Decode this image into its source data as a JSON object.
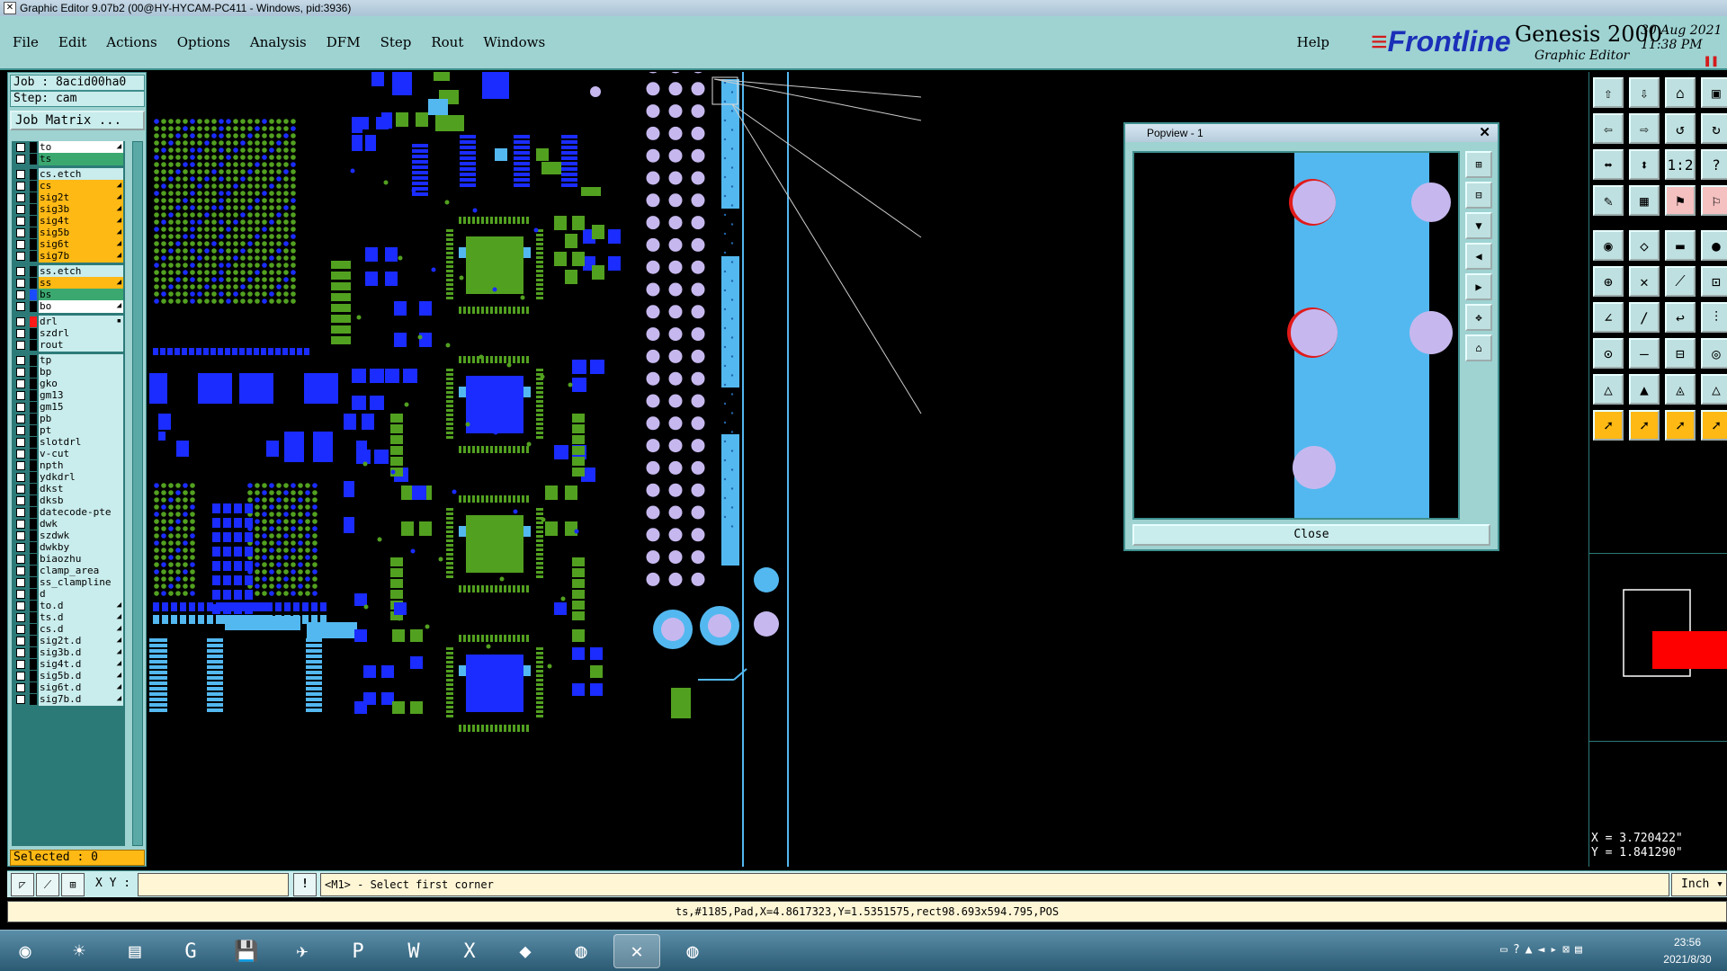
{
  "window": {
    "title": "Graphic Editor 9.07b2 (00@HY-HYCAM-PC411 - Windows, pid:3936)"
  },
  "menu": {
    "items": [
      "File",
      "Edit",
      "Actions",
      "Options",
      "Analysis",
      "DFM",
      "Step",
      "Rout",
      "Windows"
    ],
    "help": "Help"
  },
  "logo": {
    "brand": "Frontline",
    "product": "Genesis 2000",
    "subtitle": "Graphic Editor",
    "date": "30 Aug 2021",
    "time": "11:38 PM"
  },
  "job": {
    "job_label": "Job : 8acid00ha0",
    "step_label": "Step: cam",
    "matrix_button": "Job Matrix ..."
  },
  "layers": [
    {
      "name": "to",
      "color": "#000000",
      "style": "white",
      "mark": "◢"
    },
    {
      "name": "ts",
      "color": "#000000",
      "style": "green",
      "mark": ""
    },
    {
      "name": "cs.etch",
      "color": "#000000",
      "style": "normal",
      "mark": ""
    },
    {
      "name": "cs",
      "color": "#000000",
      "style": "orange",
      "mark": "◢"
    },
    {
      "name": "sig2t",
      "color": "#000000",
      "style": "orange",
      "mark": "◢"
    },
    {
      "name": "sig3b",
      "color": "#000000",
      "style": "orange",
      "mark": "◢"
    },
    {
      "name": "sig4t",
      "color": "#000000",
      "style": "orange",
      "mark": "◢"
    },
    {
      "name": "sig5b",
      "color": "#000000",
      "style": "orange",
      "mark": "◢"
    },
    {
      "name": "sig6t",
      "color": "#000000",
      "style": "orange",
      "mark": "◢"
    },
    {
      "name": "sig7b",
      "color": "#000000",
      "style": "orange",
      "mark": "◢"
    },
    {
      "name": "ss.etch",
      "color": "#000000",
      "style": "normal",
      "mark": ""
    },
    {
      "name": "ss",
      "color": "#000000",
      "style": "orange",
      "mark": "◢"
    },
    {
      "name": "bs",
      "color": "#1a4cff",
      "style": "green",
      "mark": ""
    },
    {
      "name": "bo",
      "color": "#000000",
      "style": "white",
      "mark": "◢"
    },
    {
      "name": "drl",
      "color": "#ff1a1a",
      "style": "normal",
      "mark": "▪"
    },
    {
      "name": "szdrl",
      "color": "#000000",
      "style": "normal",
      "mark": ""
    },
    {
      "name": "rout",
      "color": "#000000",
      "style": "normal",
      "mark": ""
    },
    {
      "name": "tp",
      "color": "#000000",
      "style": "normal",
      "mark": ""
    },
    {
      "name": "bp",
      "color": "#000000",
      "style": "normal",
      "mark": ""
    },
    {
      "name": "gko",
      "color": "#000000",
      "style": "normal",
      "mark": ""
    },
    {
      "name": "gm13",
      "color": "#000000",
      "style": "normal",
      "mark": ""
    },
    {
      "name": "gm15",
      "color": "#000000",
      "style": "normal",
      "mark": ""
    },
    {
      "name": "pb",
      "color": "#000000",
      "style": "normal",
      "mark": ""
    },
    {
      "name": "pt",
      "color": "#000000",
      "style": "normal",
      "mark": ""
    },
    {
      "name": "slotdrl",
      "color": "#000000",
      "style": "normal",
      "mark": ""
    },
    {
      "name": "v-cut",
      "color": "#000000",
      "style": "normal",
      "mark": ""
    },
    {
      "name": "npth",
      "color": "#000000",
      "style": "normal",
      "mark": ""
    },
    {
      "name": "ydkdrl",
      "color": "#000000",
      "style": "normal",
      "mark": ""
    },
    {
      "name": "dkst",
      "color": "#000000",
      "style": "normal",
      "mark": ""
    },
    {
      "name": "dksb",
      "color": "#000000",
      "style": "normal",
      "mark": ""
    },
    {
      "name": "datecode-pte",
      "color": "#000000",
      "style": "normal",
      "mark": ""
    },
    {
      "name": "dwk",
      "color": "#000000",
      "style": "normal",
      "mark": ""
    },
    {
      "name": "szdwk",
      "color": "#000000",
      "style": "normal",
      "mark": ""
    },
    {
      "name": "dwkby",
      "color": "#000000",
      "style": "normal",
      "mark": ""
    },
    {
      "name": "biaozhu",
      "color": "#000000",
      "style": "normal",
      "mark": ""
    },
    {
      "name": "clamp_area",
      "color": "#000000",
      "style": "normal",
      "mark": ""
    },
    {
      "name": "ss_clampline",
      "color": "#000000",
      "style": "normal",
      "mark": ""
    },
    {
      "name": "d",
      "color": "#000000",
      "style": "normal",
      "mark": ""
    },
    {
      "name": "to.d",
      "color": "#000000",
      "style": "normal",
      "mark": "◢"
    },
    {
      "name": "ts.d",
      "color": "#000000",
      "style": "normal",
      "mark": "◢"
    },
    {
      "name": "cs.d",
      "color": "#000000",
      "style": "normal",
      "mark": "◢"
    },
    {
      "name": "sig2t.d",
      "color": "#000000",
      "style": "normal",
      "mark": "◢"
    },
    {
      "name": "sig3b.d",
      "color": "#000000",
      "style": "normal",
      "mark": "◢"
    },
    {
      "name": "sig4t.d",
      "color": "#000000",
      "style": "normal",
      "mark": "◢"
    },
    {
      "name": "sig5b.d",
      "color": "#000000",
      "style": "normal",
      "mark": "◢"
    },
    {
      "name": "sig6t.d",
      "color": "#000000",
      "style": "normal",
      "mark": "◢"
    },
    {
      "name": "sig7b.d",
      "color": "#000000",
      "style": "normal",
      "mark": "◢"
    }
  ],
  "selected_label": "Selected : 0",
  "popup": {
    "title": "Popview - 1",
    "close_label": "Close"
  },
  "coords": {
    "x": "X = 3.720422\"",
    "y": "Y = 1.841290\""
  },
  "cmd": {
    "xy_label": "X Y :",
    "xy_value": "",
    "prompt": "<M1> - Select first corner",
    "unit": "Inch"
  },
  "status": "ts,#1185,Pad,X=4.8617323,Y=1.5351575,rect98.693x594.795,POS",
  "taskbar": {
    "time": "23:56",
    "date": "2021/8/30"
  },
  "colors": {
    "pad_blue": "#1a2cff",
    "pad_green": "#52a020",
    "drill_lavender": "#c6b8ee",
    "highlight_cyan": "#53b8f0"
  }
}
